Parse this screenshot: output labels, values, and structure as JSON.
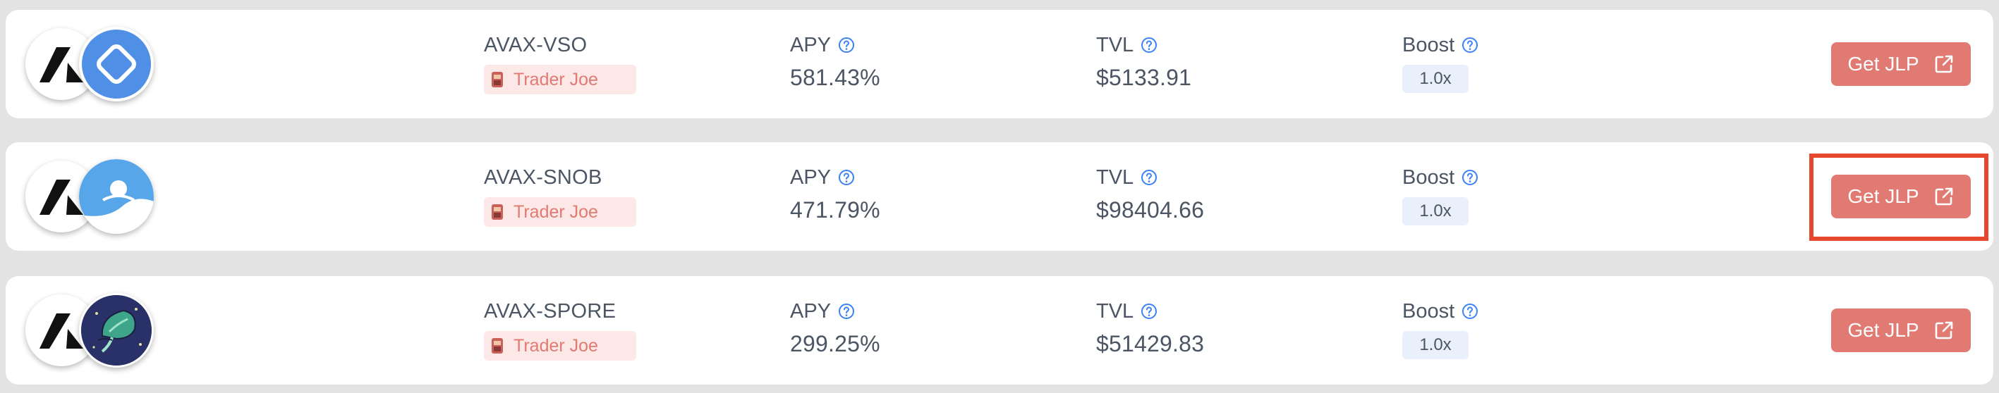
{
  "theme": {
    "accent": "#e07a72",
    "dex_badge_bg": "#fce8e6",
    "boost_badge_bg": "#e9f0fb",
    "help_icon_color": "#3b82f6",
    "highlight_color": "#e5472f",
    "page_bg": "#e3e3e3"
  },
  "labels": {
    "apy": "APY",
    "tvl": "TVL",
    "boost": "Boost",
    "get_jlp": "Get JLP"
  },
  "pools": [
    {
      "pair": "AVAX-VSO",
      "dex": "Trader Joe",
      "apy": "581.43%",
      "tvl": "$5133.91",
      "boost": "1.0x",
      "token_icon": "vso-logo-icon"
    },
    {
      "pair": "AVAX-SNOB",
      "dex": "Trader Joe",
      "apy": "471.79%",
      "tvl": "$98404.66",
      "boost": "1.0x",
      "token_icon": "snob-logo-icon",
      "highlighted": true
    },
    {
      "pair": "AVAX-SPORE",
      "dex": "Trader Joe",
      "apy": "299.25%",
      "tvl": "$51429.83",
      "boost": "1.0x",
      "token_icon": "spore-logo-icon"
    }
  ]
}
